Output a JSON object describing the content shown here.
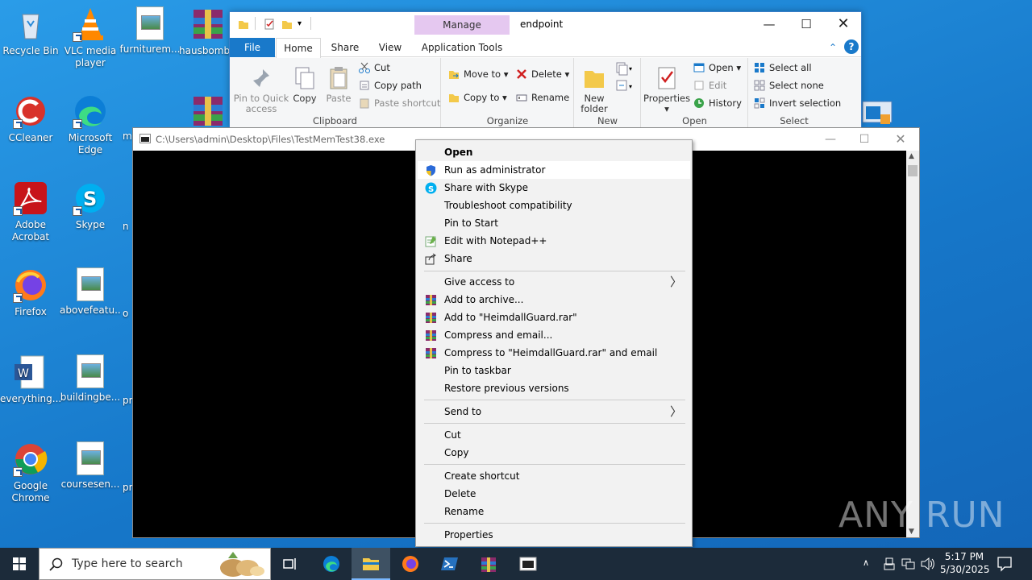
{
  "desktop": {
    "icons": [
      {
        "label": "Recycle Bin",
        "icon": "recycle-bin-icon"
      },
      {
        "label": "VLC media player",
        "icon": "vlc-icon"
      },
      {
        "label": "furniturem...",
        "icon": "image-file-icon"
      },
      {
        "label": "hausbomb",
        "icon": "winrar-icon"
      },
      {
        "label": "CCleaner",
        "icon": "ccleaner-icon"
      },
      {
        "label": "Microsoft Edge",
        "icon": "edge-icon"
      },
      {
        "label": "m",
        "icon": "image-file-icon"
      },
      {
        "label": "Adobe Acrobat",
        "icon": "acrobat-icon"
      },
      {
        "label": "Skype",
        "icon": "skype-icon"
      },
      {
        "label": "n",
        "icon": "file-icon"
      },
      {
        "label": "Firefox",
        "icon": "firefox-icon"
      },
      {
        "label": "abovefeatu...",
        "icon": "image-file-icon"
      },
      {
        "label": "o",
        "icon": "file-icon"
      },
      {
        "label": "everything...",
        "icon": "word-icon"
      },
      {
        "label": "buildingbe...",
        "icon": "image-file-icon"
      },
      {
        "label": "pr",
        "icon": "file-icon"
      },
      {
        "label": "Google Chrome",
        "icon": "chrome-icon"
      },
      {
        "label": "coursesen...",
        "icon": "image-file-icon"
      },
      {
        "label": "pr",
        "icon": "file-icon"
      }
    ]
  },
  "explorer": {
    "title": "endpoint",
    "manage_tab": "Manage",
    "tabs": {
      "file": "File",
      "home": "Home",
      "share": "Share",
      "view": "View",
      "app_tools": "Application Tools"
    },
    "clipboard": {
      "pin_label": "Pin to Quick access",
      "copy": "Copy",
      "paste": "Paste",
      "cut": "Cut",
      "copy_path": "Copy path",
      "paste_shortcut": "Paste shortcut",
      "group": "Clipboard"
    },
    "organize": {
      "move_to": "Move to",
      "copy_to": "Copy to",
      "delete": "Delete",
      "rename": "Rename",
      "group": "Organize"
    },
    "new": {
      "new_folder": "New folder",
      "group": "New"
    },
    "open": {
      "properties": "Properties",
      "open": "Open",
      "edit": "Edit",
      "history": "History",
      "group": "Open"
    },
    "select": {
      "select_all": "Select all",
      "select_none": "Select none",
      "invert": "Invert selection",
      "group": "Select"
    }
  },
  "console": {
    "title": "C:\\Users\\admin\\Desktop\\Files\\TestMemTest38.exe"
  },
  "context_menu": {
    "items": [
      {
        "label": "Open",
        "bold": true
      },
      {
        "label": "Run as administrator",
        "icon": "shield-icon"
      },
      {
        "label": "Share with Skype",
        "icon": "skype-icon"
      },
      {
        "label": "Troubleshoot compatibility"
      },
      {
        "label": "Pin to Start"
      },
      {
        "label": "Edit with Notepad++",
        "icon": "notepadpp-icon"
      },
      {
        "label": "Share",
        "icon": "share-icon"
      },
      {
        "label": "Give access to",
        "submenu": true
      },
      {
        "label": "Add to archive...",
        "icon": "winrar-icon"
      },
      {
        "label": "Add to \"HeimdallGuard.rar\"",
        "icon": "winrar-icon"
      },
      {
        "label": "Compress and email...",
        "icon": "winrar-icon"
      },
      {
        "label": "Compress to \"HeimdallGuard.rar\" and email",
        "icon": "winrar-icon"
      },
      {
        "label": "Pin to taskbar"
      },
      {
        "label": "Restore previous versions"
      },
      {
        "label": "Send to",
        "submenu": true
      },
      {
        "label": "Cut"
      },
      {
        "label": "Copy"
      },
      {
        "label": "Create shortcut"
      },
      {
        "label": "Delete"
      },
      {
        "label": "Rename"
      },
      {
        "label": "Properties"
      }
    ]
  },
  "taskbar": {
    "search_placeholder": "Type here to search",
    "time": "5:17 PM",
    "date": "5/30/2025"
  },
  "watermark": "ANY RUN"
}
